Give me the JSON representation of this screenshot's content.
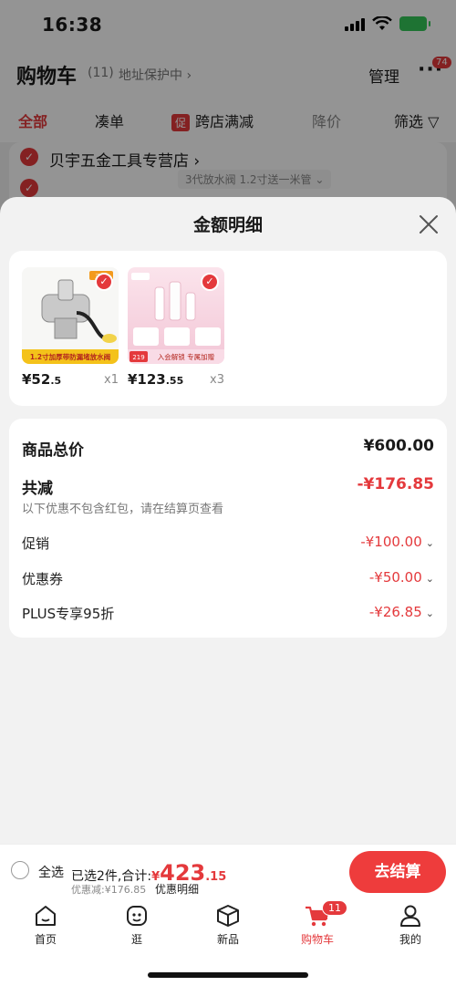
{
  "status": {
    "time": "16:38"
  },
  "cart_header": {
    "title": "购物车",
    "count": "(11)",
    "address_protect": "地址保护中",
    "manage": "管理",
    "more_badge": "74"
  },
  "filters": [
    {
      "label": "全部",
      "active": true
    },
    {
      "label": "凑单",
      "active": false
    },
    {
      "label": "跨店满减",
      "tag": "促",
      "active": false
    },
    {
      "label": "降价",
      "active": false
    },
    {
      "label": "筛选",
      "active": false
    }
  ],
  "store": {
    "name": "贝宇五金工具专营店",
    "sku_text": "3代放水阀 1.2寸送一米管"
  },
  "sheet": {
    "title": "金额明细",
    "products": [
      {
        "price_main": "¥52",
        "price_dec": ".5",
        "qty": "x1",
        "thumb_caption": "1.2寸加厚带防漏堵放水阀",
        "thumb_badge": "三代"
      },
      {
        "price_main": "¥123",
        "price_dec": ".55",
        "qty": "x3",
        "thumb_caption": "入会解锁 专属加赠",
        "thumb_badge": "219"
      }
    ],
    "summary": {
      "total_label": "商品总价",
      "total_value": "¥600.00",
      "reduce_label": "共减",
      "reduce_value": "-¥176.85",
      "note": "以下优惠不包含红包，请在结算页查看",
      "items": [
        {
          "label": "促销",
          "value": "-¥100.00"
        },
        {
          "label": "优惠券",
          "value": "-¥50.00"
        },
        {
          "label": "PLUS专享95折",
          "value": "-¥26.85"
        }
      ]
    }
  },
  "checkout": {
    "select_all": "全选",
    "selected_prefix": "已选2件,合计:",
    "currency": "¥",
    "total_int": "423",
    "total_dec": ".15",
    "discount": "优惠减:¥176.85",
    "detail": "优惠明细",
    "button": "去结算"
  },
  "tabs": [
    {
      "label": "首页",
      "icon": "home-icon"
    },
    {
      "label": "逛",
      "icon": "face-icon"
    },
    {
      "label": "新品",
      "icon": "box-icon"
    },
    {
      "label": "购物车",
      "icon": "cart-icon",
      "badge": "11",
      "active": true
    },
    {
      "label": "我的",
      "icon": "person-icon"
    }
  ],
  "colors": {
    "accent": "#e4393c",
    "checkout_button": "#ee3c3c",
    "sheet_bg": "#f2f2f2"
  }
}
